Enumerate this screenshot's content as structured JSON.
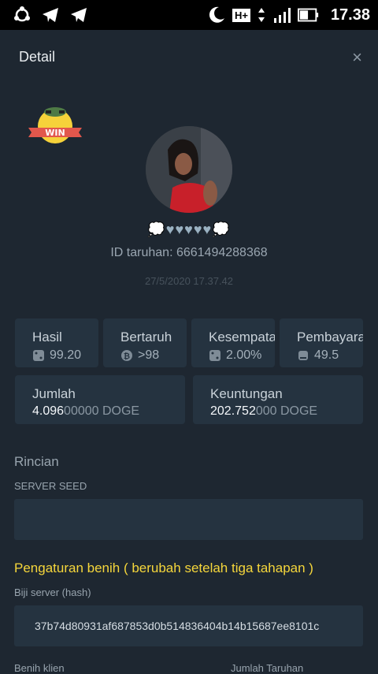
{
  "status_bar": {
    "left_icons": [
      "sync-icon",
      "telegram-icon",
      "telegram-icon"
    ],
    "right_icons": [
      "moon-icon",
      "hplus-icon",
      "data-arrows-icon",
      "signal-icon",
      "battery-icon"
    ],
    "network": "H+",
    "time": "17.38"
  },
  "header": {
    "title": "Detail",
    "close": "×"
  },
  "badge": {
    "text": "WIN"
  },
  "user": {
    "hearts": "💭♥♥♥♥♥💭",
    "bet_id": "ID taruhan: 6661494288368",
    "date": "27/5/2020 17.37.42"
  },
  "stats": [
    {
      "label": "Hasil",
      "value": "99.20",
      "icon": "dice-icon"
    },
    {
      "label": "Bertaruh",
      "value": ">98",
      "icon": "bitcoin-icon"
    },
    {
      "label": "Kesempatan",
      "value": "2.00%",
      "icon": "dice-icon"
    },
    {
      "label": "Pembayaran",
      "value": "49.5",
      "icon": "payout-icon"
    }
  ],
  "amount": {
    "label": "Jumlah",
    "value_main": "4.096",
    "value_rest": "00000 DOGE"
  },
  "profit": {
    "label": "Keuntungan",
    "value_main": "202.752",
    "value_rest": "000 DOGE"
  },
  "details": {
    "title": "Rincian",
    "server_seed_label": "SERVER SEED",
    "server_seed_value": ""
  },
  "seed_settings": {
    "title": "Pengaturan benih ( berubah setelah tiga tahapan )",
    "server_hash_label": "Biji server (hash)",
    "server_hash_value": "37b74d80931af687853d0b514836404b14b15687ee8101c",
    "client_seed_label": "Benih klien",
    "bet_count_label": "Jumlah Taruhan"
  },
  "colors": {
    "background": "#1e2731",
    "card": "#253340",
    "accent_yellow": "#f5d63b"
  }
}
